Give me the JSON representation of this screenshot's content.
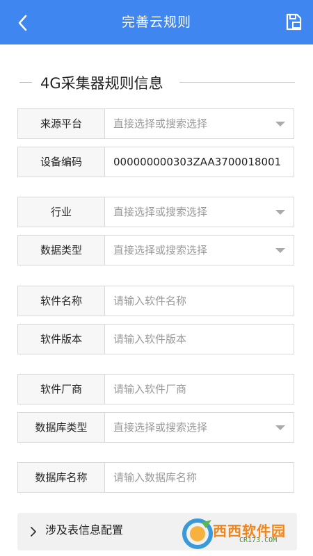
{
  "header": {
    "title": "完善云规则"
  },
  "section": {
    "title": "4G采集器规则信息"
  },
  "fields": [
    {
      "label": "来源平台",
      "value": "直接选择或搜索选择",
      "kind": "select"
    },
    {
      "label": "设备编码",
      "value": "000000000303ZAA3700018001",
      "kind": "text"
    },
    {
      "label": "行业",
      "value": "直接选择或搜索选择",
      "kind": "select"
    },
    {
      "label": "数据类型",
      "value": "直接选择或搜索选择",
      "kind": "select"
    },
    {
      "label": "软件名称",
      "value": "请输入软件名称",
      "kind": "input"
    },
    {
      "label": "软件版本",
      "value": "请输入软件版本",
      "kind": "input"
    },
    {
      "label": "软件厂商",
      "value": "请输入软件厂商",
      "kind": "input"
    },
    {
      "label": "数据库类型",
      "value": "直接选择或搜索选择",
      "kind": "select"
    },
    {
      "label": "数据库名称",
      "value": "请输入数据库名称",
      "kind": "input"
    }
  ],
  "config": {
    "label": "涉及表信息配置"
  },
  "watermark": {
    "brand": "西西软件园",
    "url": "CR173.COM"
  },
  "colors": {
    "header": "#3f86f0",
    "placeholder": "#9a9a9a",
    "label_bg": "#f7f7f7"
  }
}
